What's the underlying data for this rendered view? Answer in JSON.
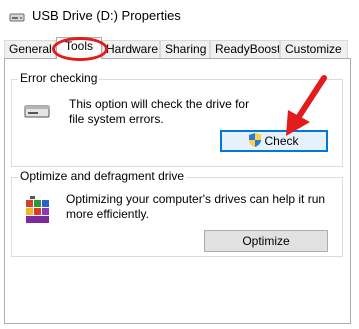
{
  "window": {
    "title": "USB Drive (D:) Properties"
  },
  "tabs": [
    {
      "label": "General"
    },
    {
      "label": "Tools"
    },
    {
      "label": "Hardware"
    },
    {
      "label": "Sharing"
    },
    {
      "label": "ReadyBoost"
    },
    {
      "label": "Customize"
    }
  ],
  "error_checking": {
    "heading": "Error checking",
    "description": "This option will check the drive for file system errors.",
    "button_label": "Check"
  },
  "optimize": {
    "heading": "Optimize and defragment drive",
    "description": "Optimizing your computer's drives can help it run more efficiently.",
    "button_label": "Optimize"
  },
  "colors": {
    "annotation_red": "#e21b1b",
    "focus_blue": "#0078d7"
  }
}
